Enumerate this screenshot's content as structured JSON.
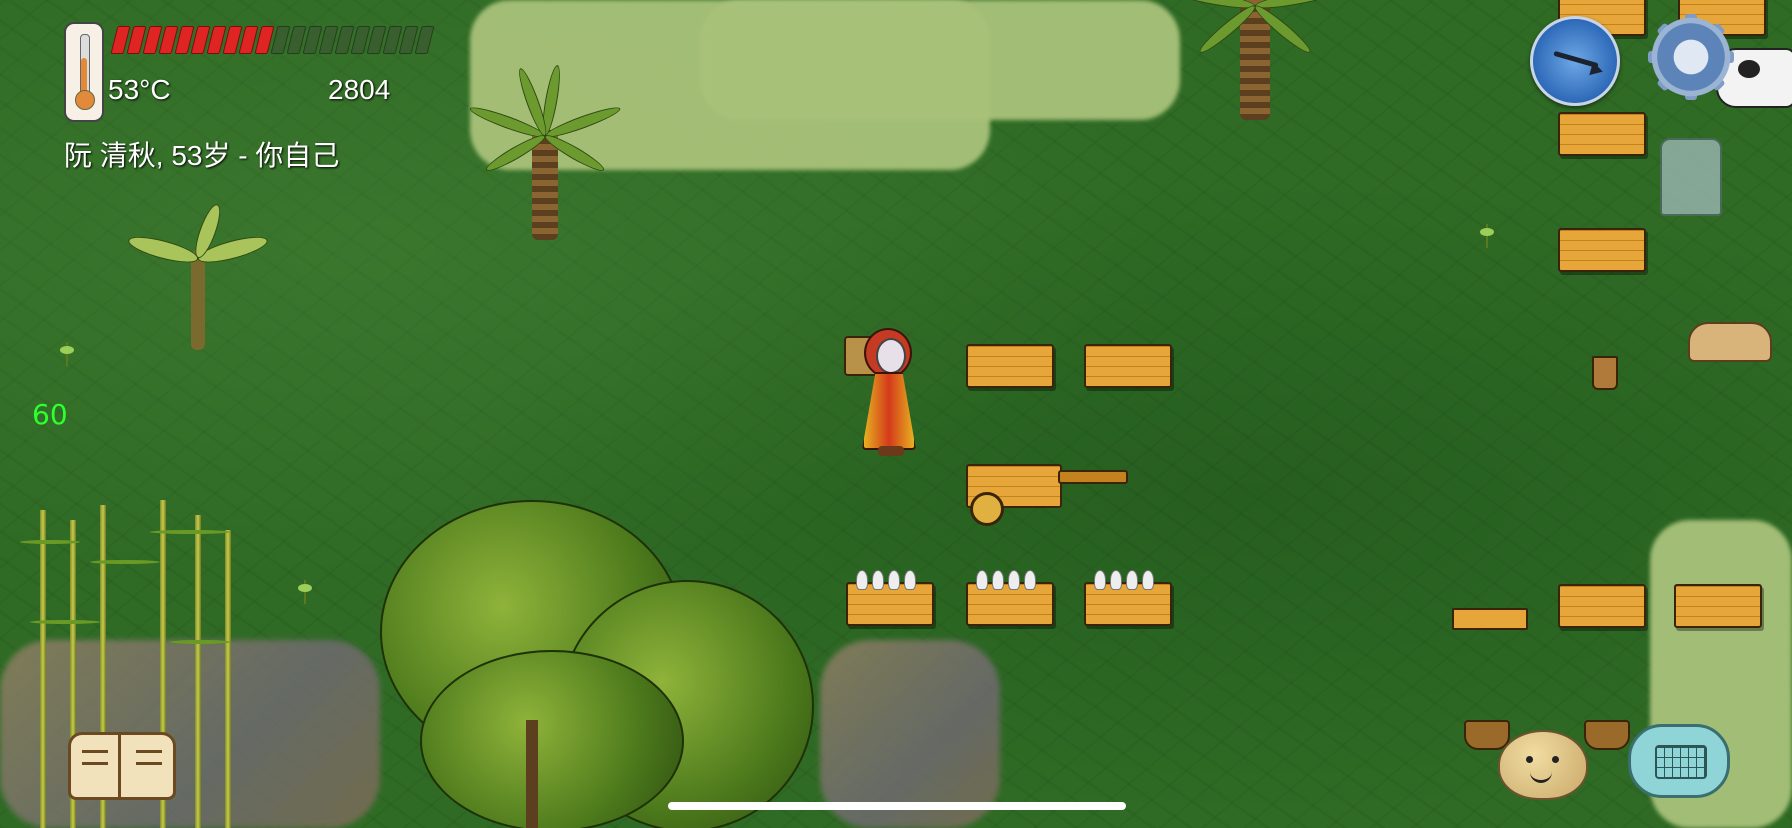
{
  "hud": {
    "temperature": "53°C",
    "yum_score": "2804",
    "player_label": "阮 清秋, 53岁 - 你自己",
    "fps": "60",
    "food_bar": {
      "filled": 10,
      "total": 20,
      "filled_color": "#e02424"
    }
  },
  "icons": {
    "thermometer": "thermometer-icon",
    "compass": "compass-icon",
    "settings": "gear-icon",
    "clothing": "clothing-icon",
    "recipe_book": "book-icon",
    "emote": "face-icon",
    "chat": "keyboard-icon"
  },
  "colors": {
    "grass": "#2f6b25",
    "fps_text": "#2eff2e",
    "hud_text": "#ffffff"
  }
}
